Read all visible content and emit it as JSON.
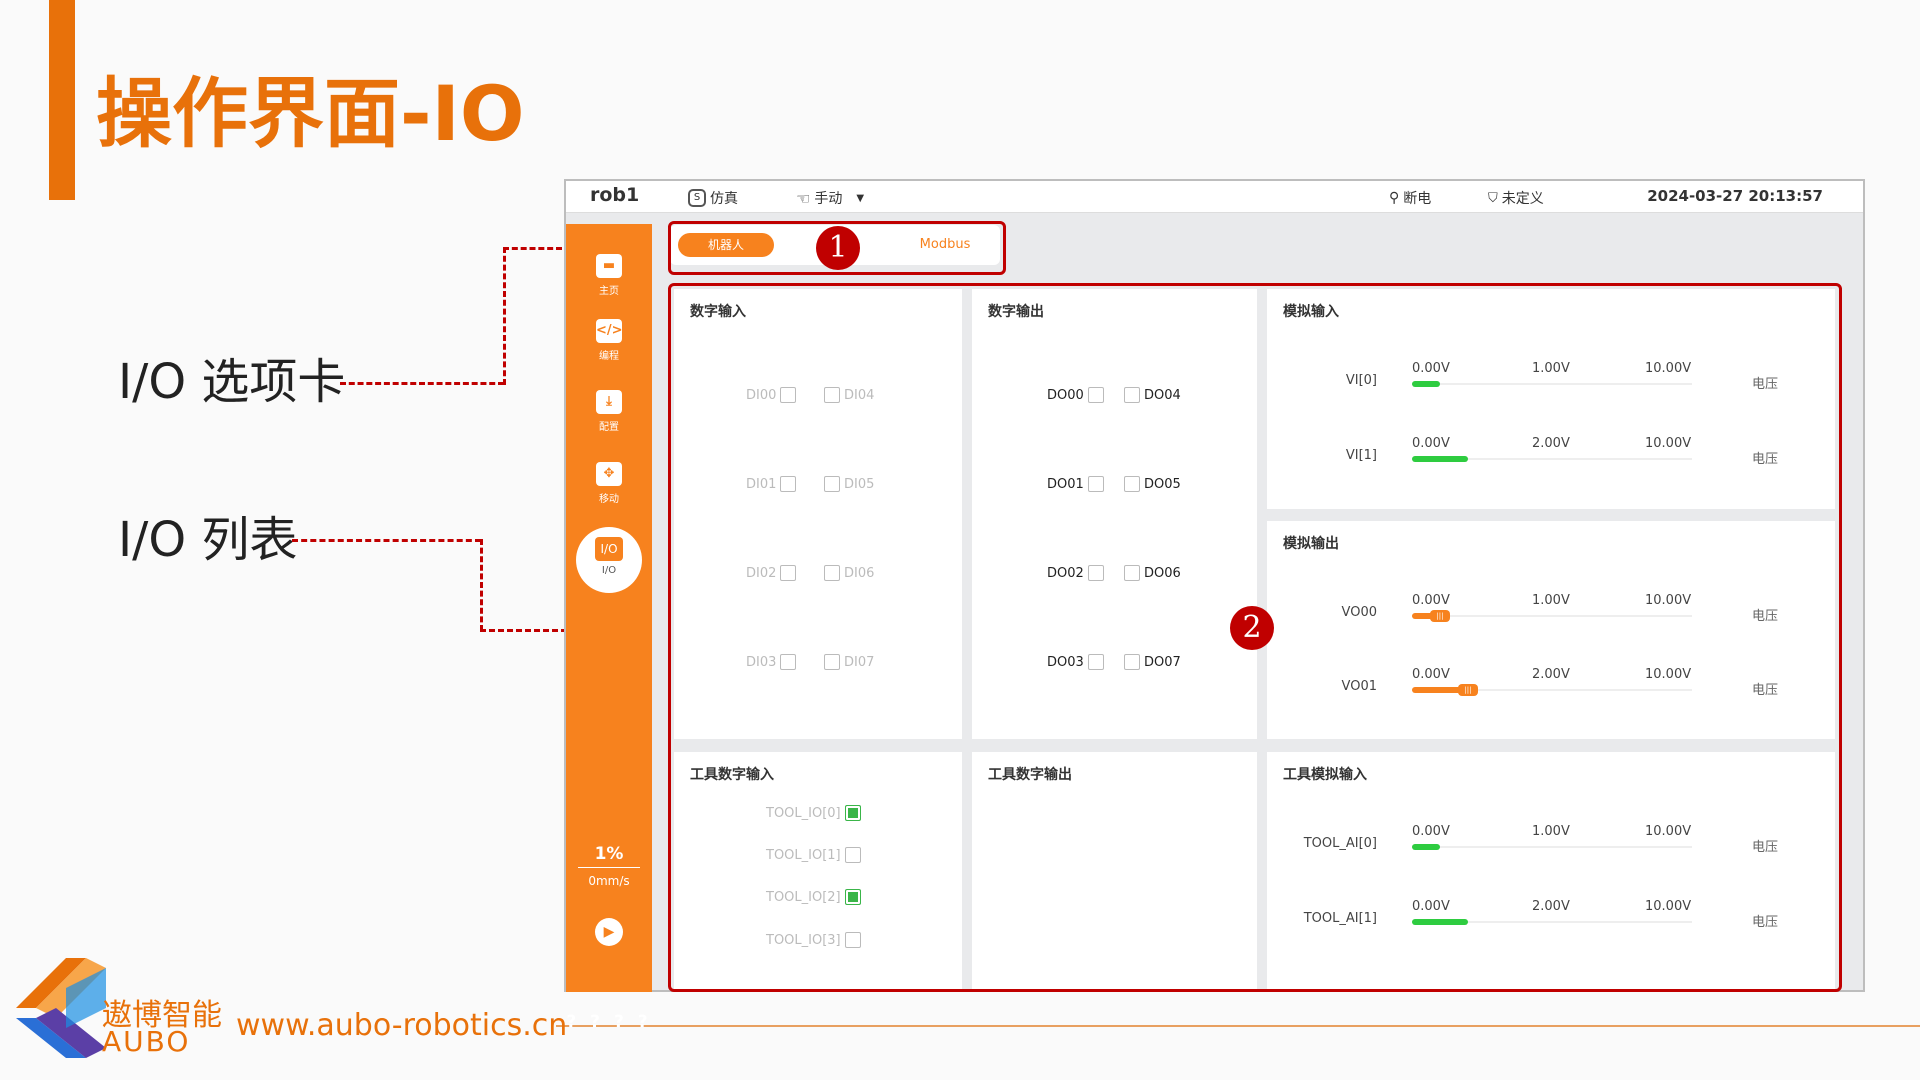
{
  "slide": {
    "title": "操作界面-IO",
    "label_tabs": "I/O 选项卡",
    "label_list": "I/O 列表",
    "logo_zh": "遨博智能",
    "logo_en": "AUBO",
    "url": "www.aubo-robotics.cn",
    "accent": "#e8710a"
  },
  "topbar": {
    "robot": "rob1",
    "mode": "仿真",
    "control": "手动",
    "power": "断电",
    "safety": "未定义",
    "datetime": "2024-03-27 20:13:57"
  },
  "sidebar": {
    "items": [
      {
        "label": "主页",
        "icon": "home-icon"
      },
      {
        "label": "编程",
        "icon": "code-icon"
      },
      {
        "label": "配置",
        "icon": "config-icon"
      },
      {
        "label": "移动",
        "icon": "move-icon"
      },
      {
        "label": "I/O",
        "icon": "io-icon"
      }
    ],
    "active_icon_text": "I/O",
    "speed_percent": "1%",
    "speed_value": "0mm/s",
    "help": "? ? ? ?"
  },
  "tabs": {
    "robot": "机器人",
    "modbus": "Modbus"
  },
  "annotations": {
    "one": "1",
    "two": "2"
  },
  "digital_input": {
    "title": "数字输入",
    "items": [
      "DI00",
      "DI01",
      "DI02",
      "DI03",
      "DI04",
      "DI05",
      "DI06",
      "DI07"
    ]
  },
  "digital_output": {
    "title": "数字输出",
    "items": [
      "DO00",
      "DO01",
      "DO02",
      "DO03",
      "DO04",
      "DO05",
      "DO06",
      "DO07"
    ]
  },
  "analog_input": {
    "title": "模拟输入",
    "rows": [
      {
        "name": "VI[0]",
        "min": "0.00V",
        "cur": "1.00V",
        "max": "10.00V",
        "unit": "电压",
        "level": 0.1
      },
      {
        "name": "VI[1]",
        "min": "0.00V",
        "cur": "2.00V",
        "max": "10.00V",
        "unit": "电压",
        "level": 0.2
      }
    ]
  },
  "analog_output": {
    "title": "模拟输出",
    "rows": [
      {
        "name": "VO00",
        "min": "0.00V",
        "cur": "1.00V",
        "max": "10.00V",
        "unit": "电压",
        "level": 0.1
      },
      {
        "name": "VO01",
        "min": "0.00V",
        "cur": "2.00V",
        "max": "10.00V",
        "unit": "电压",
        "level": 0.2
      }
    ]
  },
  "tool_digital_input": {
    "title": "工具数字输入",
    "items": [
      {
        "name": "TOOL_IO[0]",
        "on": true
      },
      {
        "name": "TOOL_IO[1]",
        "on": false
      },
      {
        "name": "TOOL_IO[2]",
        "on": true
      },
      {
        "name": "TOOL_IO[3]",
        "on": false
      }
    ]
  },
  "tool_digital_output": {
    "title": "工具数字输出"
  },
  "tool_analog_input": {
    "title": "工具模拟输入",
    "rows": [
      {
        "name": "TOOL_AI[0]",
        "min": "0.00V",
        "cur": "1.00V",
        "max": "10.00V",
        "unit": "电压",
        "level": 0.1
      },
      {
        "name": "TOOL_AI[1]",
        "min": "0.00V",
        "cur": "2.00V",
        "max": "10.00V",
        "unit": "电压",
        "level": 0.2
      }
    ]
  }
}
